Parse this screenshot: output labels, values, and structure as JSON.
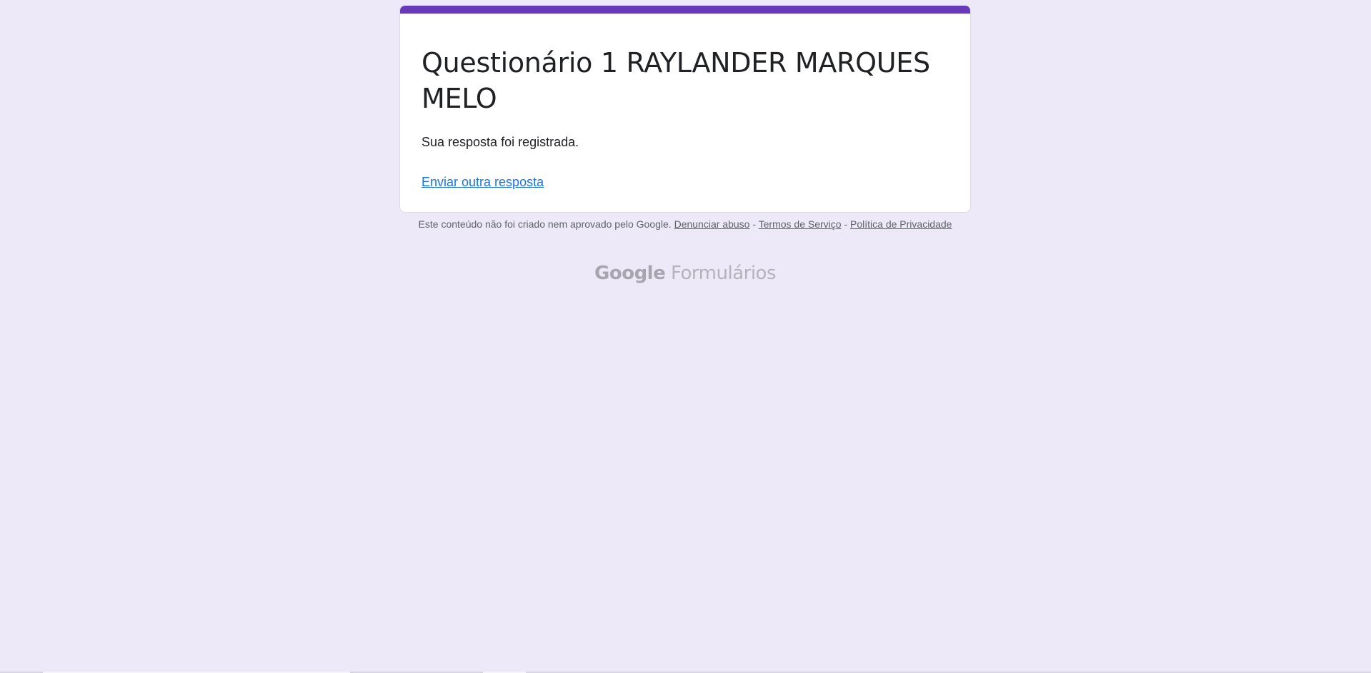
{
  "form": {
    "title": "Questionário 1 RAYLANDER MARQUES MELO",
    "confirmation_message": "Sua resposta foi registrada.",
    "submit_another_link": "Enviar outra resposta"
  },
  "footer": {
    "disclaimer": "Este conteúdo não foi criado nem aprovado pelo Google.",
    "report_abuse": "Denunciar abuso",
    "separator": " - ",
    "terms": "Termos de Serviço",
    "privacy": "Política de Privacidade"
  },
  "brand": {
    "google": "Google",
    "product": "Formulários"
  },
  "colors": {
    "background": "#ede9f8",
    "accent": "#673ab7",
    "link": "#1a73e8"
  }
}
